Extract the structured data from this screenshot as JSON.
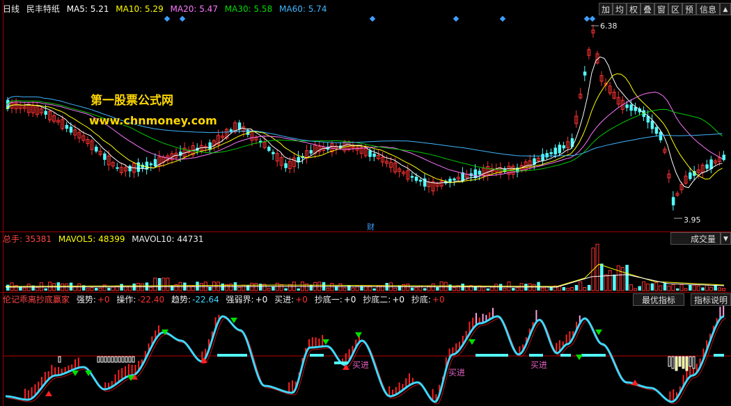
{
  "price_panel": {
    "period": "日线",
    "stock_name": "民丰特纸",
    "ma": [
      {
        "label": "MA5: 5.21",
        "color": "#ffffff"
      },
      {
        "label": "MA10: 5.29",
        "color": "#ffff00"
      },
      {
        "label": "MA20: 5.47",
        "color": "#ff77ff"
      },
      {
        "label": "MA30: 5.58",
        "color": "#00dd00"
      },
      {
        "label": "MA60: 5.74",
        "color": "#3fb6ff"
      }
    ],
    "toolbar": [
      "加",
      "均",
      "权",
      "叠",
      "窗",
      "区",
      "预",
      "信息"
    ],
    "high_label": "6.38",
    "low_label": "3.95",
    "fin_marker": "财",
    "watermark_cn": "第一股票公式网",
    "watermark_url": "www.chnmoney.com"
  },
  "volume_panel": {
    "total_label": "总手: 35381",
    "mavol5": "MAVOL5: 48399",
    "mavol10": "MAVOL10: 44731",
    "selector_label": "成交量"
  },
  "indicator_panel": {
    "name": "伦记乖离抄底赢家",
    "fields": [
      {
        "label": "强势:",
        "value": "+0",
        "color": "#ff3333"
      },
      {
        "label": "操作:",
        "value": "-22.40",
        "color": "#ff3333"
      },
      {
        "label": "趋势:",
        "value": "-22.64",
        "color": "#3fd8ff"
      },
      {
        "label": "强弱界:",
        "value": "+0",
        "color": "#ffffff"
      },
      {
        "label": "买进:",
        "value": "+0",
        "color": "#ff3333"
      },
      {
        "label": "抄底一:",
        "value": "+0",
        "color": "#ffffff"
      },
      {
        "label": "抄底二:",
        "value": "+0",
        "color": "#ffffff"
      },
      {
        "label": "抄底:",
        "value": "+0",
        "color": "#ff3333"
      }
    ],
    "buttons": [
      "最优指标",
      "指标说明"
    ],
    "buy_labels": [
      "买进",
      "买进",
      "买进"
    ]
  },
  "colors": {
    "up": "#ff3232",
    "down": "#54ffff",
    "grid": "#a00000",
    "curve": "#3fd8ff"
  }
}
